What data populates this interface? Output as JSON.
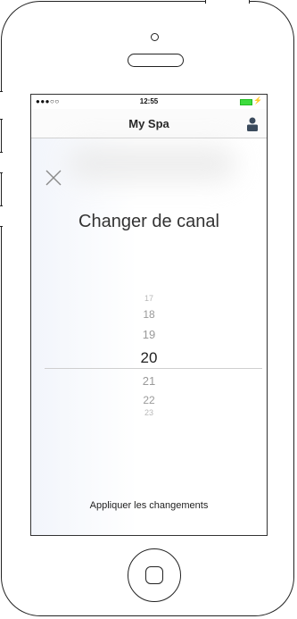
{
  "status_bar": {
    "signal": "●●●○○ ",
    "time": "12:55",
    "battery_color": "#3ddc3d"
  },
  "nav": {
    "title": "My Spa",
    "profile_icon": "person-icon",
    "icon_color": "#3a4a5c"
  },
  "dialog": {
    "close_icon": "close-icon",
    "title": "Changer de canal"
  },
  "picker": {
    "values": [
      "17",
      "18",
      "19",
      "20",
      "21",
      "22",
      "23"
    ],
    "selected": "20"
  },
  "apply_label": "Appliquer les changements"
}
